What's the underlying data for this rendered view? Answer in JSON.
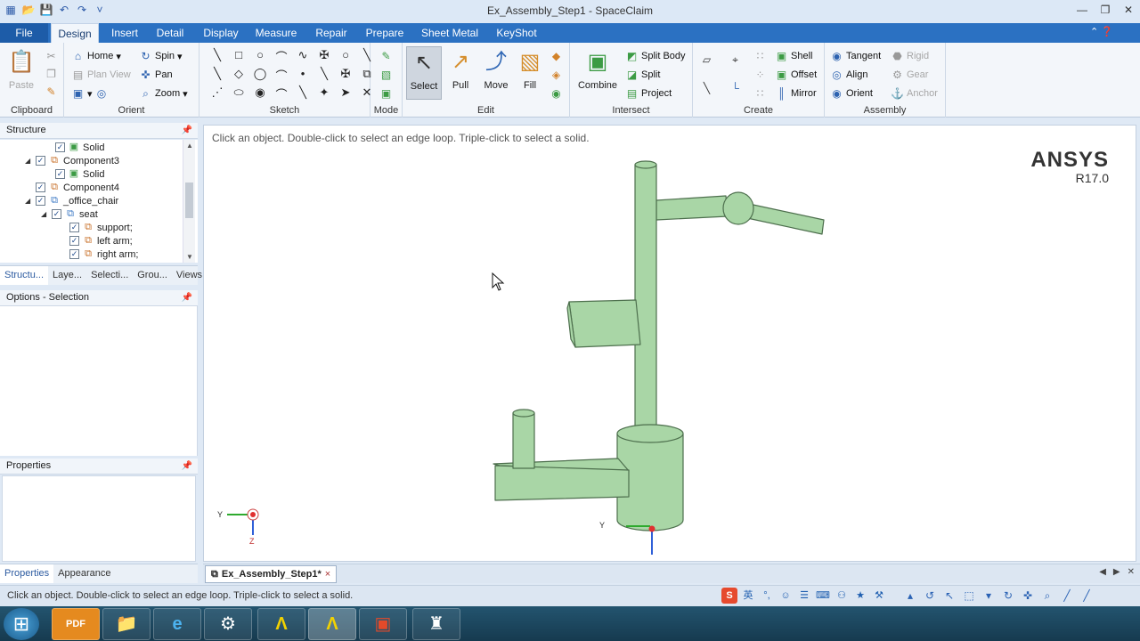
{
  "window": {
    "title": "Ex_Assembly_Step1 - SpaceClaim"
  },
  "quick_access": [
    "▦",
    "📂",
    "💾",
    "↶",
    "↷",
    "˅"
  ],
  "window_controls": {
    "minimize": "—",
    "restore": "❐",
    "close": "✕"
  },
  "tabs": {
    "file": "File",
    "items": [
      "Design",
      "Insert",
      "Detail",
      "Display",
      "Measure",
      "Repair",
      "Prepare",
      "Sheet Metal",
      "KeyShot"
    ],
    "active": "Design"
  },
  "ribbon": {
    "clipboard": {
      "label": "Clipboard",
      "paste": "Paste"
    },
    "orient": {
      "label": "Orient",
      "home": "Home",
      "spin": "Spin",
      "plan_view": "Plan View",
      "pan": "Pan",
      "zoom": "Zoom"
    },
    "sketch": {
      "label": "Sketch"
    },
    "mode": {
      "label": "Mode"
    },
    "edit": {
      "label": "Edit",
      "select": "Select",
      "pull": "Pull",
      "move": "Move",
      "fill": "Fill"
    },
    "intersect": {
      "label": "Intersect",
      "combine": "Combine",
      "split_body": "Split Body",
      "split": "Split",
      "project": "Project"
    },
    "create": {
      "label": "Create",
      "shell": "Shell",
      "offset": "Offset",
      "mirror": "Mirror"
    },
    "assembly": {
      "label": "Assembly",
      "tangent": "Tangent",
      "align": "Align",
      "orient": "Orient",
      "rigid": "Rigid",
      "gear": "Gear",
      "anchor": "Anchor"
    }
  },
  "structure": {
    "title": "Structure",
    "tree": [
      {
        "label": "Solid"
      },
      {
        "label": "Component3"
      },
      {
        "label": "Solid"
      },
      {
        "label": "Component4"
      },
      {
        "label": "_office_chair"
      },
      {
        "label": "seat"
      },
      {
        "label": "support;"
      },
      {
        "label": "left arm;"
      },
      {
        "label": "right arm;"
      }
    ],
    "tabs": [
      "Structu...",
      "Laye...",
      "Selecti...",
      "Grou...",
      "Views"
    ]
  },
  "options": {
    "title": "Options - Selection"
  },
  "properties": {
    "title": "Properties",
    "tabs": [
      "Properties",
      "Appearance"
    ]
  },
  "viewport": {
    "hint": "Click an object. Double-click to select an edge loop. Triple-click to select a solid.",
    "brand": "ANSYS",
    "version": "R17.0",
    "model_color": "#a9d6a6",
    "edge_color": "#4d6f4d",
    "triad_labels": {
      "y": "Y",
      "z": "Z"
    }
  },
  "document_tab": {
    "label": "Ex_Assembly_Step1*",
    "close": "×"
  },
  "status": {
    "text": "Click an object. Double-click to select an edge loop. Triple-click to select a solid."
  },
  "ime": [
    "S",
    "英",
    "°,",
    "☺",
    "☰",
    "⌨",
    "⚇",
    "★",
    "⚒"
  ],
  "taskbar": {
    "start": "⊞",
    "apps": [
      "PDF",
      "📁",
      "e",
      "⚙",
      "Λ",
      "Λ",
      "▣",
      "♜"
    ]
  }
}
